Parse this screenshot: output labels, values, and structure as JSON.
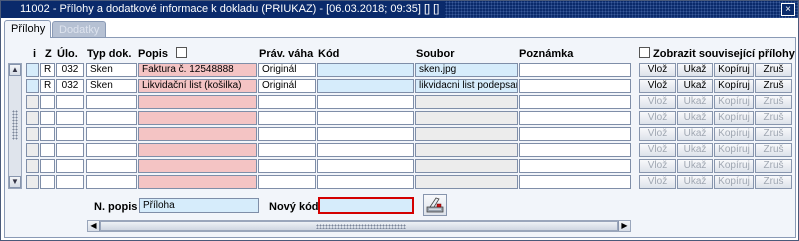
{
  "window": {
    "title": "11002 - Přílohy a dodatkové informace k dokladu (PRIUKAZ) - [06.03.2018; 09:35] [] []",
    "icon_text": "IF",
    "close_glyph": "×"
  },
  "tabs": [
    {
      "label": "Přílohy",
      "active": true
    },
    {
      "label": "Dodatky",
      "active": false
    }
  ],
  "columns": {
    "i": "i",
    "z": "Z",
    "ulo": "Úlo.",
    "typ": "Typ dok.",
    "popis": "Popis",
    "prav": "Práv. váha",
    "kod": "Kód",
    "soubor": "Soubor",
    "poznamka": "Poznámka"
  },
  "show_related_label": "Zobrazit související přílohy",
  "rows": [
    {
      "i": "",
      "z": "R",
      "ulo": "032",
      "typ": "Sken",
      "popis": "Faktura č. 12548888",
      "prav": "Originál",
      "kod": "",
      "soubor": "sken.jpg",
      "poznamka": "",
      "enabled": true
    },
    {
      "i": "",
      "z": "R",
      "ulo": "032",
      "typ": "Sken",
      "popis": "Likvidační list (košilka)",
      "prav": "Originál",
      "kod": "",
      "soubor": "likvidacni list podepsany.",
      "poznamka": "",
      "enabled": true
    },
    {
      "i": "",
      "z": "",
      "ulo": "",
      "typ": "",
      "popis": "",
      "prav": "",
      "kod": "",
      "soubor": "",
      "poznamka": "",
      "enabled": false
    },
    {
      "i": "",
      "z": "",
      "ulo": "",
      "typ": "",
      "popis": "",
      "prav": "",
      "kod": "",
      "soubor": "",
      "poznamka": "",
      "enabled": false
    },
    {
      "i": "",
      "z": "",
      "ulo": "",
      "typ": "",
      "popis": "",
      "prav": "",
      "kod": "",
      "soubor": "",
      "poznamka": "",
      "enabled": false
    },
    {
      "i": "",
      "z": "",
      "ulo": "",
      "typ": "",
      "popis": "",
      "prav": "",
      "kod": "",
      "soubor": "",
      "poznamka": "",
      "enabled": false
    },
    {
      "i": "",
      "z": "",
      "ulo": "",
      "typ": "",
      "popis": "",
      "prav": "",
      "kod": "",
      "soubor": "",
      "poznamka": "",
      "enabled": false
    },
    {
      "i": "",
      "z": "",
      "ulo": "",
      "typ": "",
      "popis": "",
      "prav": "",
      "kod": "",
      "soubor": "",
      "poznamka": "",
      "enabled": false
    }
  ],
  "row_buttons": {
    "vloz": "Vlož",
    "ukaz": "Ukaž",
    "kopiruj": "Kopíruj",
    "zrus": "Zruš"
  },
  "footer": {
    "n_popis_label": "N. popis",
    "n_popis_value": "Příloha",
    "novy_kod_label": "Nový kód",
    "novy_kod_value": ""
  },
  "scroll": {
    "up": "▲",
    "down": "▼",
    "left": "◀",
    "right": "▶"
  },
  "colors": {
    "titlebar": "#0a2a6b",
    "required_field": "#f4c4c4",
    "selected_field": "#d6ecfb",
    "focus_border": "#d40000"
  },
  "icons": {
    "image_button": "scanner-icon"
  }
}
